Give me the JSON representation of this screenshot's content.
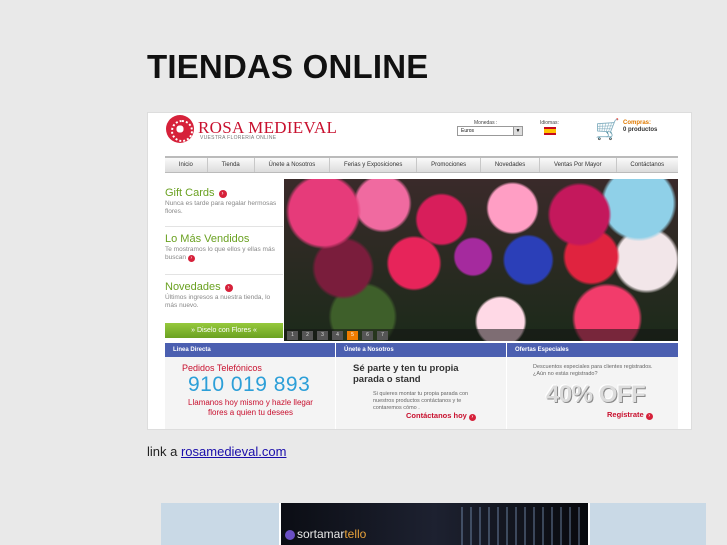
{
  "page": {
    "title": "TIENDAS ONLINE",
    "link_prefix": "link a ",
    "link_text": "rosamedieval.com"
  },
  "store": {
    "brand": "ROSA MEDIEVAL",
    "tagline": "VUESTRA FLORERIA ONLINE",
    "monedas_label": "Monedas :",
    "currency": "Euros",
    "idiomas_label": "Idiomas:",
    "cart_title": "Compras:",
    "cart_count": "0 productos",
    "nav": [
      "Inicio",
      "Tienda",
      "Únete a Nosotros",
      "Ferias y Exposiciones",
      "Promociones",
      "Novedades",
      "Ventas Por Mayor",
      "Contáctanos"
    ],
    "promos": [
      {
        "title": "Gift Cards",
        "text": "Nunca es tarde para regalar hermosas flores."
      },
      {
        "title": "Lo Más Vendidos",
        "text": "Te mostramos lo que ellos y ellas más buscan"
      },
      {
        "title": "Novedades",
        "text": "Últimos ingresos a nuestra tienda, lo más nuevo."
      }
    ],
    "promo_arrow": "›",
    "green_button": "»  Diselo con Flores  «",
    "slides": [
      "1",
      "2",
      "3",
      "4",
      "5",
      "6",
      "7"
    ],
    "columns": {
      "c1_title": "Linea Directa",
      "c2_title": "Únete a Nosotros",
      "c3_title": "Ofertas Especiales"
    },
    "pedidos": "Pedidos Telefónicos",
    "phone": "910 019 893",
    "llamanos": "Llamanos hoy mismo y hazle llegar flores a quien tu desees",
    "separte": "Sé parte y ten tu propia parada o stand",
    "separte_text": "Si quieres montar tu propia parada con nuestros productos contáctanos y te contaremos cómo .",
    "contact_link": "Contáctanos hoy",
    "descuentos": "Descuentos especiales para clientes registrados. ¿Aún no estás registrado?",
    "off": "40% OFF",
    "register_link": "Regístrate"
  },
  "bottom": {
    "brand_a": "sortamar",
    "brand_b": "tello"
  },
  "colors": {
    "accent_red": "#c8102e",
    "accent_green": "#6aa121",
    "accent_blue": "#4b5fb0",
    "phone_blue": "#2c9fd8"
  }
}
